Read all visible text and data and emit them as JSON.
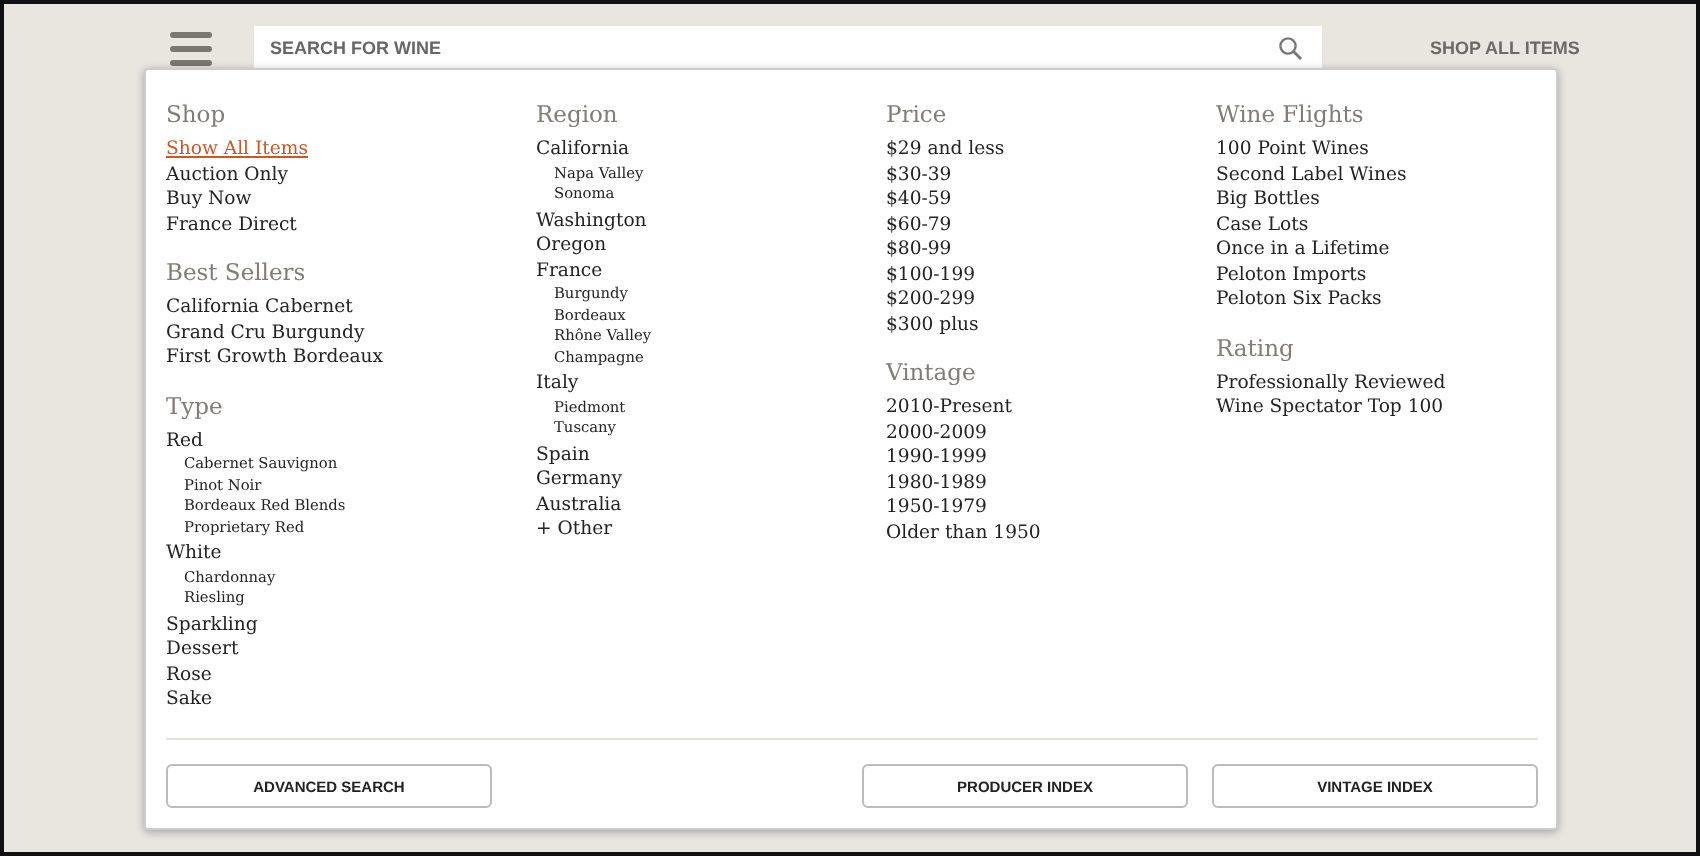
{
  "header": {
    "search": {
      "placeholder": "SEARCH FOR WINE"
    },
    "shop_all": "SHOP ALL ITEMS"
  },
  "menu": {
    "columns": [
      [
        {
          "heading": "Shop",
          "items": [
            {
              "label": "Show All Items",
              "selected": true
            },
            {
              "label": "Auction Only",
              "selected": false
            },
            {
              "label": "Buy Now",
              "selected": false
            },
            {
              "label": "France Direct",
              "selected": false
            }
          ]
        },
        {
          "heading": "Best Sellers",
          "items": [
            {
              "label": "California Cabernet",
              "selected": false
            },
            {
              "label": "Grand Cru Burgundy",
              "selected": false
            },
            {
              "label": "First Growth Bordeaux",
              "selected": false
            }
          ]
        },
        {
          "heading": "Type",
          "items": [
            {
              "label": "Red",
              "selected": false,
              "children": [
                {
                  "label": "Cabernet Sauvignon",
                  "selected": false
                },
                {
                  "label": "Pinot Noir",
                  "selected": false
                },
                {
                  "label": "Bordeaux Red Blends",
                  "selected": false
                },
                {
                  "label": "Proprietary Red",
                  "selected": false
                }
              ]
            },
            {
              "label": "White",
              "selected": false,
              "children": [
                {
                  "label": "Chardonnay",
                  "selected": false
                },
                {
                  "label": "Riesling",
                  "selected": false
                }
              ]
            },
            {
              "label": "Sparkling",
              "selected": false
            },
            {
              "label": "Dessert",
              "selected": false
            },
            {
              "label": "Rose",
              "selected": false
            },
            {
              "label": "Sake",
              "selected": false
            }
          ]
        }
      ],
      [
        {
          "heading": "Region",
          "items": [
            {
              "label": "California",
              "selected": false,
              "children": [
                {
                  "label": "Napa Valley",
                  "selected": false
                },
                {
                  "label": "Sonoma",
                  "selected": false
                }
              ]
            },
            {
              "label": "Washington",
              "selected": false
            },
            {
              "label": "Oregon",
              "selected": false
            },
            {
              "label": "France",
              "selected": false,
              "children": [
                {
                  "label": "Burgundy",
                  "selected": false
                },
                {
                  "label": "Bordeaux",
                  "selected": false
                },
                {
                  "label": "Rhône Valley",
                  "selected": false
                },
                {
                  "label": "Champagne",
                  "selected": false
                }
              ]
            },
            {
              "label": "Italy",
              "selected": false,
              "children": [
                {
                  "label": "Piedmont",
                  "selected": false
                },
                {
                  "label": "Tuscany",
                  "selected": false
                }
              ]
            },
            {
              "label": "Spain",
              "selected": false
            },
            {
              "label": "Germany",
              "selected": false
            },
            {
              "label": "Australia",
              "selected": false
            },
            {
              "label": "+ Other",
              "selected": false
            }
          ]
        }
      ],
      [
        {
          "heading": "Price",
          "items": [
            {
              "label": "$29 and less",
              "selected": false
            },
            {
              "label": "$30-39",
              "selected": false
            },
            {
              "label": "$40-59",
              "selected": false
            },
            {
              "label": "$60-79",
              "selected": false
            },
            {
              "label": "$80-99",
              "selected": false
            },
            {
              "label": "$100-199",
              "selected": false
            },
            {
              "label": "$200-299",
              "selected": false
            },
            {
              "label": "$300 plus",
              "selected": false
            }
          ]
        },
        {
          "heading": "Vintage",
          "items": [
            {
              "label": "2010-Present",
              "selected": false
            },
            {
              "label": "2000-2009",
              "selected": false
            },
            {
              "label": "1990-1999",
              "selected": false
            },
            {
              "label": "1980-1989",
              "selected": false
            },
            {
              "label": "1950-1979",
              "selected": false
            },
            {
              "label": "Older than 1950",
              "selected": false
            }
          ]
        }
      ],
      [
        {
          "heading": "Wine Flights",
          "items": [
            {
              "label": "100 Point Wines",
              "selected": false
            },
            {
              "label": "Second Label Wines",
              "selected": false
            },
            {
              "label": "Big Bottles",
              "selected": false
            },
            {
              "label": "Case Lots",
              "selected": false
            },
            {
              "label": "Once in a Lifetime",
              "selected": false
            },
            {
              "label": "Peloton Imports",
              "selected": false
            },
            {
              "label": "Peloton Six Packs",
              "selected": false
            }
          ]
        },
        {
          "heading": "Rating",
          "items": [
            {
              "label": "Professionally Reviewed",
              "selected": false
            },
            {
              "label": "Wine Spectator Top 100",
              "selected": false
            }
          ]
        }
      ]
    ],
    "buttons": [
      "ADVANCED SEARCH",
      "PRODUCER INDEX",
      "VINTAGE INDEX"
    ]
  }
}
